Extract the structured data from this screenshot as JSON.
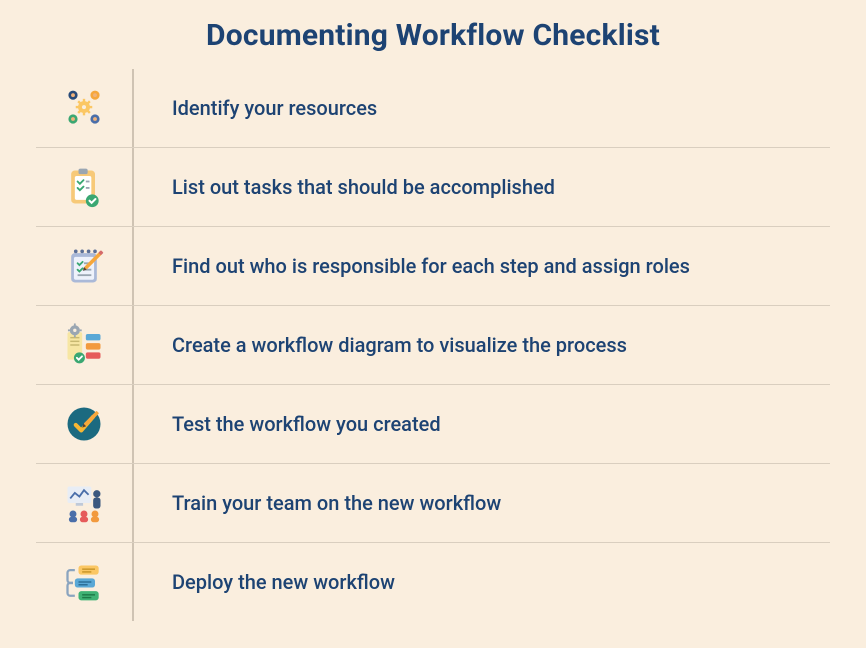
{
  "title": "Documenting Workflow Checklist",
  "accent_color": "#1d4373",
  "items": [
    {
      "icon": "resources-icon",
      "text": "Identify your resources"
    },
    {
      "icon": "tasks-clipboard-icon",
      "text": "List out tasks that should be accomplished"
    },
    {
      "icon": "notepad-roles-icon",
      "text": "Find out who is responsible for each step and assign roles"
    },
    {
      "icon": "workflow-diagram-icon",
      "text": "Create a workflow diagram to visualize the process"
    },
    {
      "icon": "test-check-icon",
      "text": "Test the workflow you created"
    },
    {
      "icon": "train-team-icon",
      "text": "Train your team on the new workflow"
    },
    {
      "icon": "deploy-icon",
      "text": "Deploy the new workflow"
    }
  ]
}
